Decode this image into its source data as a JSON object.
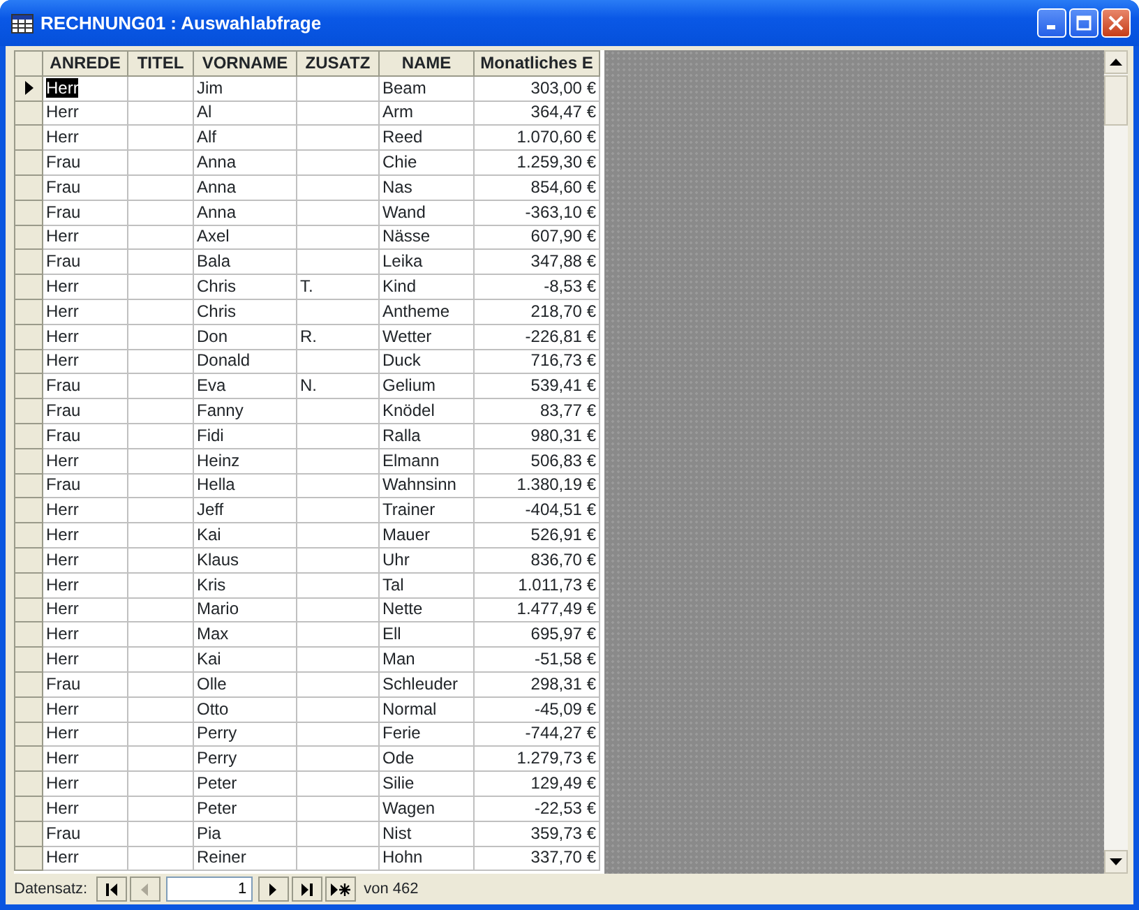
{
  "window": {
    "title": "RECHNUNG01 : Auswahlabfrage"
  },
  "table": {
    "columns": [
      "ANREDE",
      "TITEL",
      "VORNAME",
      "ZUSATZ",
      "NAME",
      "Monatliches E"
    ],
    "rows": [
      {
        "selected": true,
        "cells": [
          "Herr",
          "",
          "Jim",
          "",
          "Beam",
          "303,00 €"
        ]
      },
      {
        "selected": false,
        "cells": [
          "Herr",
          "",
          "Al",
          "",
          "Arm",
          "364,47 €"
        ]
      },
      {
        "selected": false,
        "cells": [
          "Herr",
          "",
          "Alf",
          "",
          "Reed",
          "1.070,60 €"
        ]
      },
      {
        "selected": false,
        "cells": [
          "Frau",
          "",
          "Anna",
          "",
          "Chie",
          "1.259,30 €"
        ]
      },
      {
        "selected": false,
        "cells": [
          "Frau",
          "",
          "Anna",
          "",
          "Nas",
          "854,60 €"
        ]
      },
      {
        "selected": false,
        "cells": [
          "Frau",
          "",
          "Anna",
          "",
          "Wand",
          "-363,10 €"
        ]
      },
      {
        "selected": false,
        "cells": [
          "Herr",
          "",
          "Axel",
          "",
          "Nässe",
          "607,90 €"
        ]
      },
      {
        "selected": false,
        "cells": [
          "Frau",
          "",
          "Bala",
          "",
          "Leika",
          "347,88 €"
        ]
      },
      {
        "selected": false,
        "cells": [
          "Herr",
          "",
          "Chris",
          "T.",
          "Kind",
          "-8,53 €"
        ]
      },
      {
        "selected": false,
        "cells": [
          "Herr",
          "",
          "Chris",
          "",
          "Antheme",
          "218,70 €"
        ]
      },
      {
        "selected": false,
        "cells": [
          "Herr",
          "",
          "Don",
          "R.",
          "Wetter",
          "-226,81 €"
        ]
      },
      {
        "selected": false,
        "cells": [
          "Herr",
          "",
          "Donald",
          "",
          "Duck",
          "716,73 €"
        ]
      },
      {
        "selected": false,
        "cells": [
          "Frau",
          "",
          "Eva",
          "N.",
          "Gelium",
          "539,41 €"
        ]
      },
      {
        "selected": false,
        "cells": [
          "Frau",
          "",
          "Fanny",
          "",
          "Knödel",
          "83,77 €"
        ]
      },
      {
        "selected": false,
        "cells": [
          "Frau",
          "",
          "Fidi",
          "",
          "Ralla",
          "980,31 €"
        ]
      },
      {
        "selected": false,
        "cells": [
          "Herr",
          "",
          "Heinz",
          "",
          "Elmann",
          "506,83 €"
        ]
      },
      {
        "selected": false,
        "cells": [
          "Frau",
          "",
          "Hella",
          "",
          "Wahnsinn",
          "1.380,19 €"
        ]
      },
      {
        "selected": false,
        "cells": [
          "Herr",
          "",
          "Jeff",
          "",
          "Trainer",
          "-404,51 €"
        ]
      },
      {
        "selected": false,
        "cells": [
          "Herr",
          "",
          "Kai",
          "",
          "Mauer",
          "526,91 €"
        ]
      },
      {
        "selected": false,
        "cells": [
          "Herr",
          "",
          "Klaus",
          "",
          "Uhr",
          "836,70 €"
        ]
      },
      {
        "selected": false,
        "cells": [
          "Herr",
          "",
          "Kris",
          "",
          "Tal",
          "1.011,73 €"
        ]
      },
      {
        "selected": false,
        "cells": [
          "Herr",
          "",
          "Mario",
          "",
          "Nette",
          "1.477,49 €"
        ]
      },
      {
        "selected": false,
        "cells": [
          "Herr",
          "",
          "Max",
          "",
          "Ell",
          "695,97 €"
        ]
      },
      {
        "selected": false,
        "cells": [
          "Herr",
          "",
          "Kai",
          "",
          "Man",
          "-51,58 €"
        ]
      },
      {
        "selected": false,
        "cells": [
          "Frau",
          "",
          "Olle",
          "",
          "Schleuder",
          "298,31 €"
        ]
      },
      {
        "selected": false,
        "cells": [
          "Herr",
          "",
          "Otto",
          "",
          "Normal",
          "-45,09 €"
        ]
      },
      {
        "selected": false,
        "cells": [
          "Herr",
          "",
          "Perry",
          "",
          "Ferie",
          "-744,27 €"
        ]
      },
      {
        "selected": false,
        "cells": [
          "Herr",
          "",
          "Perry",
          "",
          "Ode",
          "1.279,73 €"
        ]
      },
      {
        "selected": false,
        "cells": [
          "Herr",
          "",
          "Peter",
          "",
          "Silie",
          "129,49 €"
        ]
      },
      {
        "selected": false,
        "cells": [
          "Herr",
          "",
          "Peter",
          "",
          "Wagen",
          "-22,53 €"
        ]
      },
      {
        "selected": false,
        "cells": [
          "Frau",
          "",
          "Pia",
          "",
          "Nist",
          "359,73 €"
        ]
      },
      {
        "selected": false,
        "cells": [
          "Herr",
          "",
          "Reiner",
          "",
          "Hohn",
          "337,70 €"
        ]
      }
    ]
  },
  "navigator": {
    "label": "Datensatz:",
    "buttons": [
      {
        "kind": "first",
        "disabled": false
      },
      {
        "kind": "prev",
        "disabled": true
      }
    ],
    "record": "1",
    "buttons_after": [
      {
        "kind": "next",
        "disabled": false
      },
      {
        "kind": "last",
        "disabled": false
      },
      {
        "kind": "new",
        "disabled": false
      }
    ],
    "total": "von 462"
  }
}
